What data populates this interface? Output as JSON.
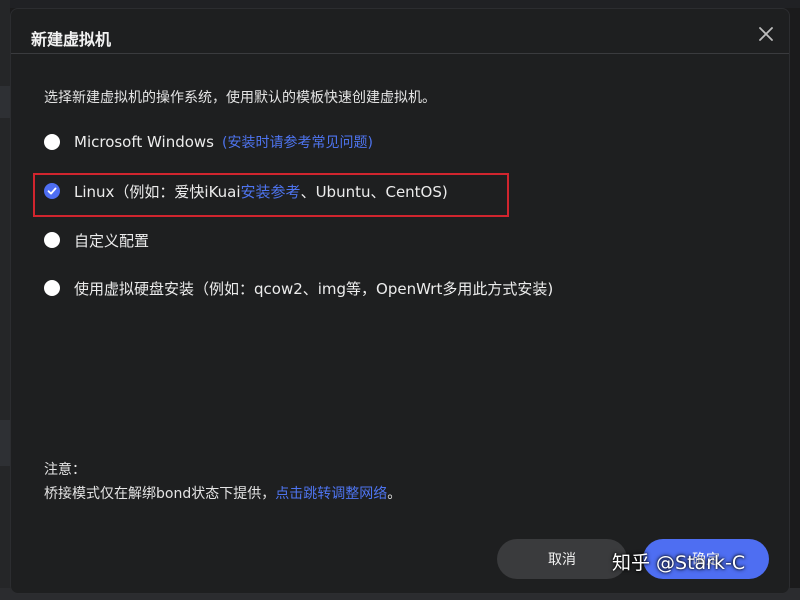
{
  "dialog": {
    "title": "新建虚拟机",
    "intro": "选择新建虚拟机的操作系统，使用默认的模板快速创建虚拟机。",
    "options": [
      {
        "label": "Microsoft Windows",
        "link": "(安装时请参考常见问题)",
        "checked": false
      },
      {
        "label_prefix": "Linux（例如：爱快iKuai",
        "link": "安装参考",
        "label_suffix": "、Ubuntu、CentOS)",
        "checked": true
      },
      {
        "label": "自定义配置",
        "checked": false
      },
      {
        "label": "使用虚拟硬盘安装（例如：qcow2、img等，OpenWrt多用此方式安装)",
        "checked": false
      }
    ],
    "note_title": "注意：",
    "note_text": "桥接模式仅在解绑bond状态下提供，",
    "note_link": "点击跳转调整网络",
    "note_end": "。",
    "cancel_label": "取消",
    "ok_label": "确定"
  },
  "watermark": "知乎 @Stark-C",
  "colors": {
    "accent": "#4e6ef2",
    "link": "#4e74ef",
    "highlight_border": "#d1252e",
    "dialog_bg": "#1e1f20"
  },
  "icons": {
    "close": "close-icon",
    "check": "check-icon"
  }
}
